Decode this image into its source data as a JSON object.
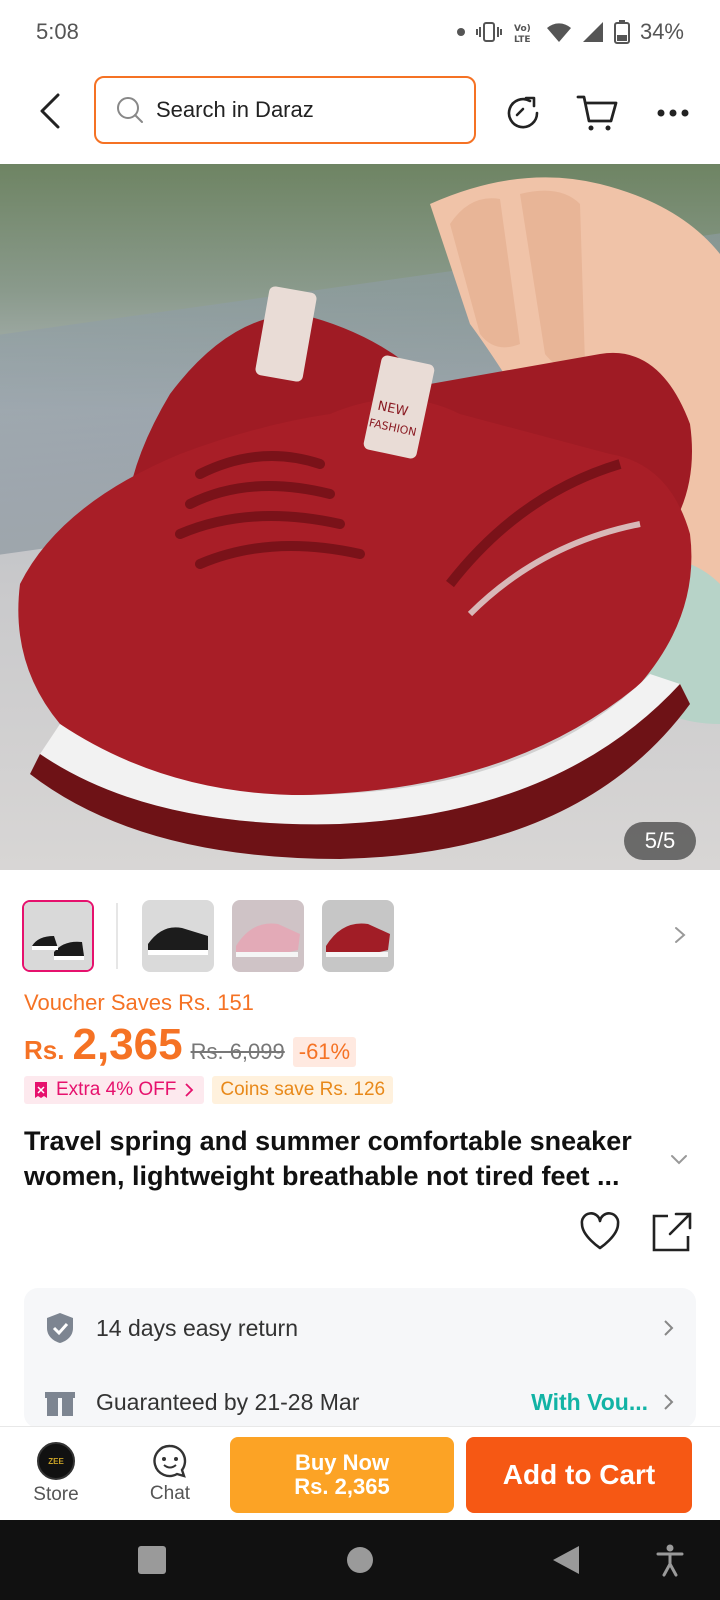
{
  "status": {
    "time": "5:08",
    "battery": "34%",
    "lte_label": "Vo) LTE"
  },
  "header": {
    "search_placeholder": "Search in Daraz",
    "icons": [
      "back-arrow-icon",
      "search-icon",
      "share-refresh-icon",
      "cart-icon",
      "more-icon"
    ]
  },
  "gallery": {
    "counter": "5/5",
    "thumbnails": [
      {
        "name": "black-sneaker-pair",
        "selected": true
      },
      {
        "name": "black-sneaker-side",
        "selected": false
      },
      {
        "name": "pink-sneaker",
        "selected": false
      },
      {
        "name": "red-sneaker",
        "selected": false
      }
    ]
  },
  "pricing": {
    "voucher_text": "Voucher Saves Rs. 151",
    "currency": "Rs.",
    "price": "2,365",
    "old_price": "Rs. 6,099",
    "discount": "-61%",
    "extra_off": "Extra 4% OFF",
    "coins_save": "Coins save Rs. 126"
  },
  "product": {
    "title": "Travel spring and summer comfortable sneaker women, lightweight breathable not tired feet ..."
  },
  "services": [
    {
      "icon": "shield-check-icon",
      "text": "14 days easy return",
      "extra": ""
    },
    {
      "icon": "gift-box-icon",
      "text": "Guaranteed by 21-28 Mar",
      "extra": "With Vou..."
    }
  ],
  "bottom_bar": {
    "store_label": "Store",
    "store_logo_text": "ZEE",
    "chat_label": "Chat",
    "buy_now_label": "Buy Now",
    "buy_now_price": "Rs. 2,365",
    "add_to_cart_label": "Add to Cart"
  },
  "colors": {
    "accent": "#f57224",
    "buy_now": "#fca325",
    "add_to_cart": "#f65814",
    "highlight_teal": "#12b3a5",
    "pink": "#e6116d"
  }
}
